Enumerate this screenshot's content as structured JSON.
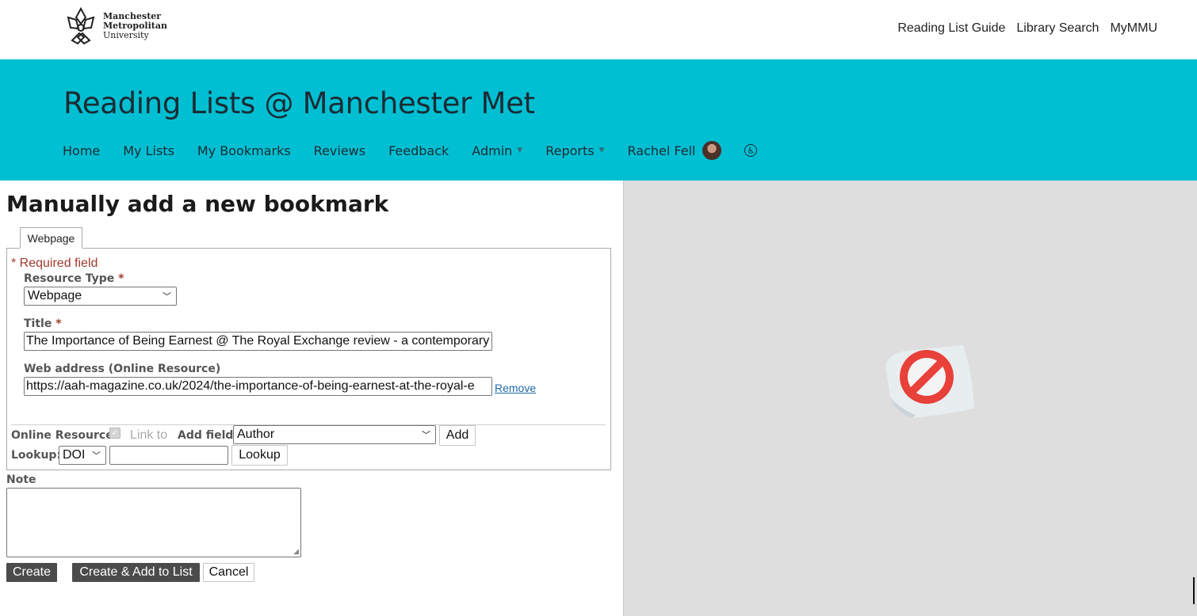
{
  "brand": {
    "line1": "Manchester",
    "line2": "Metropolitan",
    "line3": "University"
  },
  "top_links": [
    "Reading List Guide",
    "Library Search",
    "MyMMU"
  ],
  "banner": {
    "title": "Reading Lists @ Manchester Met",
    "background": "#00bfd3"
  },
  "nav": {
    "items": [
      "Home",
      "My Lists",
      "My Bookmarks",
      "Reviews",
      "Feedback",
      "Admin",
      "Reports"
    ],
    "user": "Rachel Fell",
    "accessibility_icon": "accessibility-icon"
  },
  "form": {
    "page_title": "Manually add a new bookmark",
    "tab": "Webpage",
    "required_note": "* Required field",
    "resource_type": {
      "label": "Resource Type",
      "value": "Webpage"
    },
    "title": {
      "label": "Title",
      "value": "The Importance of Being Earnest @ The Royal Exchange review - a contemporary"
    },
    "web_address": {
      "label": "Web address (Online Resource)",
      "value": "https://aah-magazine.co.uk/2024/the-importance-of-being-earnest-at-the-royal-e",
      "remove": "Remove"
    },
    "online_resource_label": "Online Resource:",
    "link_to": "Link to",
    "add_field": {
      "label": "Add field:",
      "value": "Author",
      "button": "Add"
    },
    "lookup": {
      "label": "Lookup:",
      "type": "DOI",
      "value": "",
      "button": "Lookup"
    },
    "note_label": "Note",
    "note_value": "",
    "buttons": {
      "create": "Create",
      "create_add": "Create & Add to List",
      "cancel": "Cancel"
    }
  },
  "viewer": {
    "status_icon": "blocked-icon"
  }
}
